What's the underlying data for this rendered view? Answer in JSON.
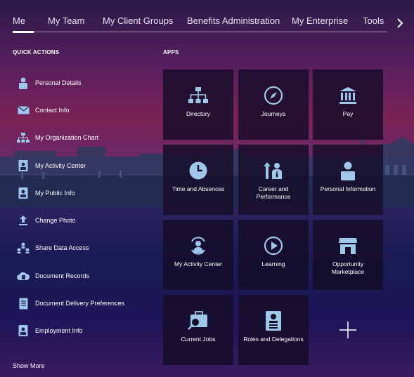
{
  "tabs": [
    "Me",
    "My Team",
    "My Client Groups",
    "Benefits Administration",
    "My Enterprise",
    "Tools"
  ],
  "quick_actions": {
    "title": "QUICK ACTIONS",
    "items": [
      {
        "label": "Personal Details",
        "icon": "person-badge-icon"
      },
      {
        "label": "Contact Info",
        "icon": "envelope-icon"
      },
      {
        "label": "My Organization Chart",
        "icon": "org-chart-icon"
      },
      {
        "label": "My Activity Center",
        "icon": "activity-badge-icon"
      },
      {
        "label": "My Public Info",
        "icon": "id-badge-icon"
      },
      {
        "label": "Change Photo",
        "icon": "upload-icon"
      },
      {
        "label": "Share Data Access",
        "icon": "share-people-icon"
      },
      {
        "label": "Document Records",
        "icon": "cloud-document-icon"
      },
      {
        "label": "Document Delivery Preferences",
        "icon": "document-icon"
      },
      {
        "label": "Employment Info",
        "icon": "id-card-icon"
      }
    ],
    "show_more": "Show More"
  },
  "apps": {
    "title": "APPS",
    "tiles": [
      {
        "label": "Directory",
        "icon": "directory-icon"
      },
      {
        "label": "Journeys",
        "icon": "compass-icon"
      },
      {
        "label": "Pay",
        "icon": "bank-icon"
      },
      {
        "label": "Time and Absences",
        "icon": "clock-icon"
      },
      {
        "label": "Career and Performance",
        "icon": "career-icon"
      },
      {
        "label": "Personal Information",
        "icon": "person-badge-icon"
      },
      {
        "label": "My Activity Center",
        "icon": "activity-person-icon"
      },
      {
        "label": "Learning",
        "icon": "play-icon"
      },
      {
        "label": "Opportunity Marketplace",
        "icon": "storefront-icon"
      },
      {
        "label": "Current Jobs",
        "icon": "briefcase-search-icon"
      },
      {
        "label": "Roles and Delegations",
        "icon": "roles-card-icon"
      }
    ],
    "add_icon": "plus-icon"
  },
  "colors": {
    "icon_blue": "#9ec7ea",
    "tile_bg": "#160c28"
  }
}
